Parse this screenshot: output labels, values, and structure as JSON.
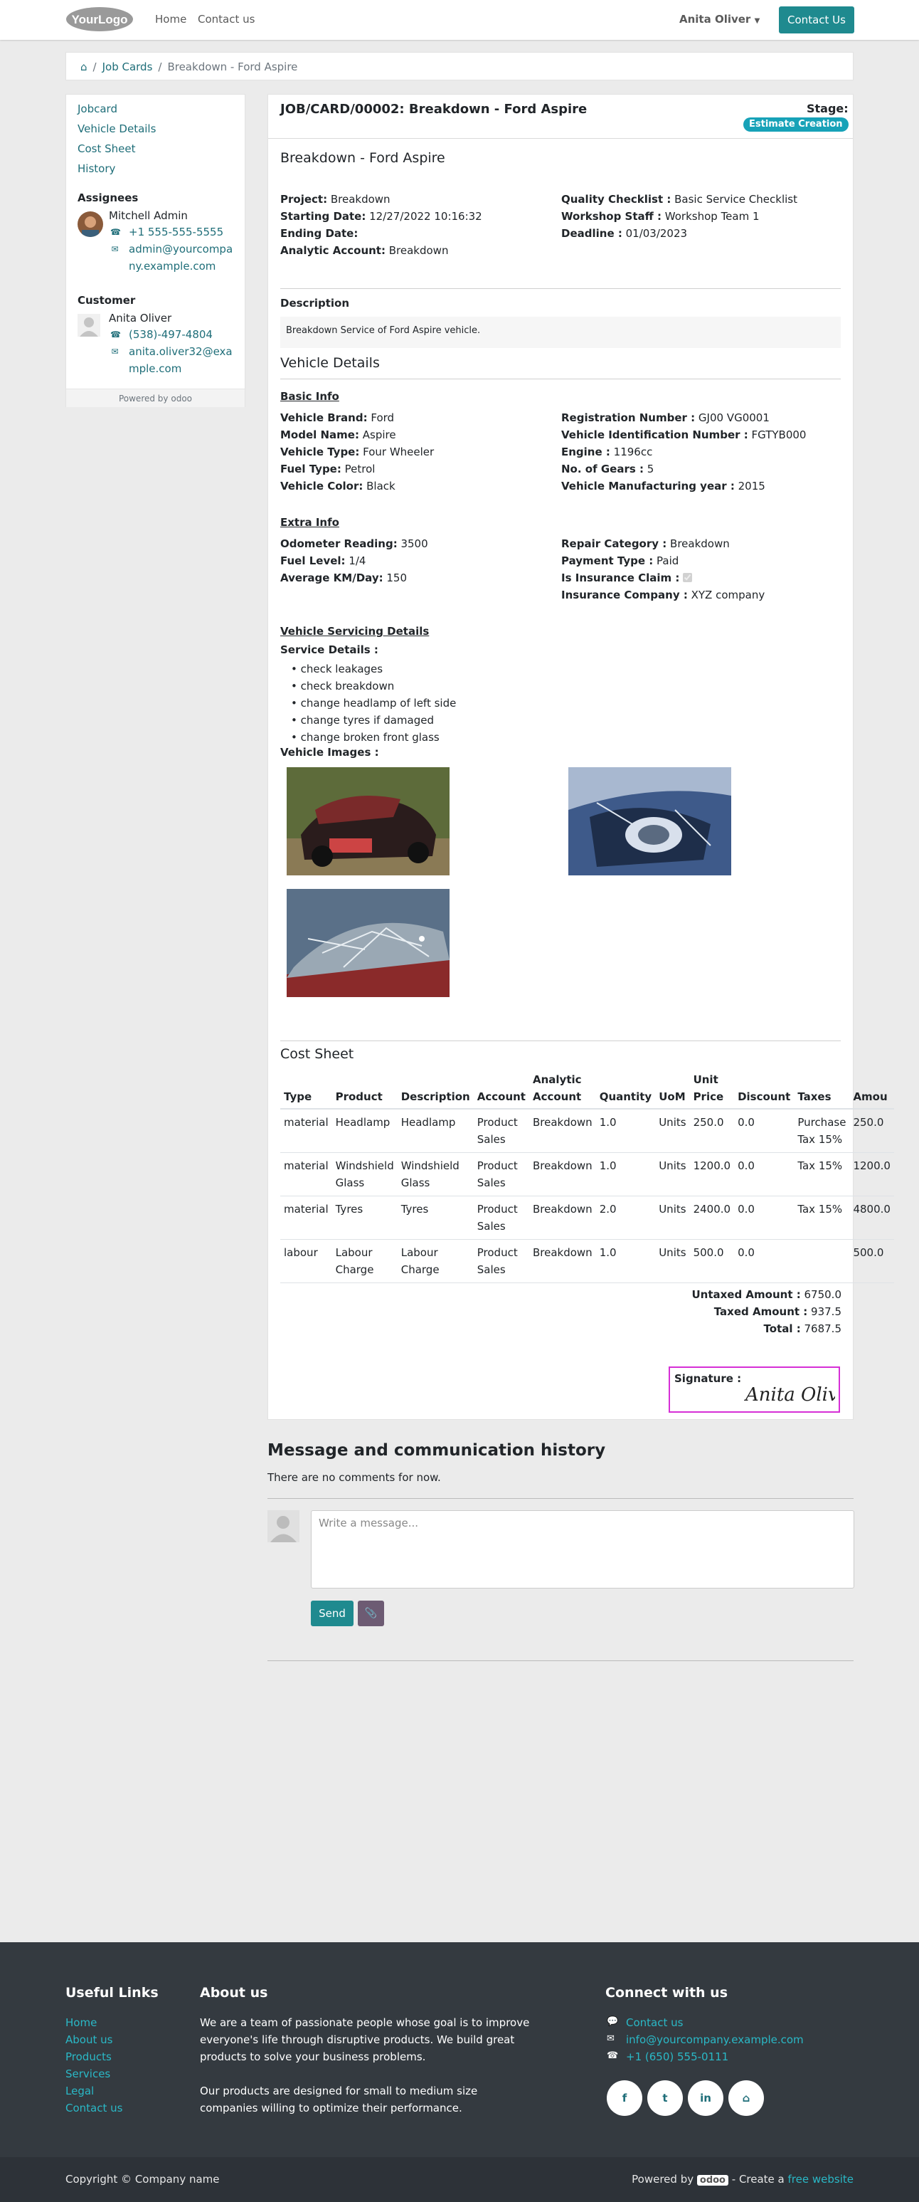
{
  "nav": {
    "logo_text": "YourLogo",
    "home": "Home",
    "contact_us": "Contact us",
    "user": "Anita Oliver",
    "cta": "Contact Us"
  },
  "breadcrumb": {
    "home_icon": "home-icon",
    "job_cards": "Job Cards",
    "current": "Breakdown - Ford Aspire"
  },
  "sidebar": {
    "links": [
      "Jobcard",
      "Vehicle Details",
      "Cost Sheet",
      "History"
    ],
    "assignees_heading": "Assignees",
    "assignee_name": "Mitchell Admin",
    "assignee_phone": "+1 555-555-5555",
    "assignee_email_1": "admin@yourcompa",
    "assignee_email_2": "ny.example.com",
    "customer_heading": "Customer",
    "customer_name": "Anita Oliver",
    "customer_phone": "(538)-497-4804",
    "customer_email_1": "anita.oliver32@exa",
    "customer_email_2": "mple.com",
    "powered_by": "Powered by",
    "odoo": "odoo"
  },
  "jobcard": {
    "header": "JOB/CARD/00002: Breakdown - Ford Aspire",
    "stage_label": "Stage:",
    "stage": "Estimate Creation",
    "title": "Breakdown - Ford Aspire",
    "left_fields": [
      {
        "label": "Project:",
        "value": " Breakdown"
      },
      {
        "label": "Starting Date:",
        "value": " 12/27/2022 10:16:32"
      },
      {
        "label": "Ending Date:",
        "value": ""
      },
      {
        "label": "Analytic Account:",
        "value": " Breakdown"
      }
    ],
    "right_fields": [
      {
        "label": "Quality Checklist :",
        "value": " Basic Service Checklist"
      },
      {
        "label": "Workshop Staff :",
        "value": " Workshop Team 1"
      },
      {
        "label": "Deadline :",
        "value": " 01/03/2023"
      }
    ],
    "description_heading": "Description",
    "description": "Breakdown Service of Ford Aspire vehicle."
  },
  "vehicle": {
    "heading": "Vehicle Details",
    "basic_heading": "Basic Info",
    "basic_left": [
      {
        "label": "Vehicle Brand:",
        "value": " Ford"
      },
      {
        "label": "Model Name:",
        "value": " Aspire"
      },
      {
        "label": "Vehicle Type:",
        "value": " Four Wheeler"
      },
      {
        "label": "Fuel Type:",
        "value": " Petrol"
      },
      {
        "label": "Vehicle Color:",
        "value": " Black"
      }
    ],
    "basic_right": [
      {
        "label": "Registration Number :",
        "value": " GJ00 VG0001"
      },
      {
        "label": "Vehicle Identification Number :",
        "value": " FGTYB000"
      },
      {
        "label": "Engine :",
        "value": " 1196cc"
      },
      {
        "label": "No. of Gears :",
        "value": " 5"
      },
      {
        "label": "Vehicle Manufacturing year :",
        "value": " 2015"
      }
    ],
    "extra_heading": "Extra Info",
    "extra_left": [
      {
        "label": "Odometer Reading:",
        "value": " 3500"
      },
      {
        "label": "Fuel Level:",
        "value": " 1/4"
      },
      {
        "label": "Average KM/Day:",
        "value": " 150"
      }
    ],
    "extra_right": [
      {
        "label": "Repair Category :",
        "value": " Breakdown"
      },
      {
        "label": "Payment Type :",
        "value": " Paid"
      },
      {
        "label": "Is Insurance Claim :",
        "value": ""
      },
      {
        "label": "Insurance Company :",
        "value": " XYZ company"
      }
    ],
    "insurance_claim_checked": true,
    "servicing_heading": "Vehicle Servicing Details",
    "service_details_label": "Service Details :",
    "services": [
      "check leakages",
      "check breakdown",
      "change headlamp of left side",
      "change tyres if damaged",
      "change broken front glass"
    ],
    "images_label": "Vehicle Images :"
  },
  "cost": {
    "heading": "Cost Sheet",
    "columns": [
      "Type",
      "Product",
      "Description",
      "Account",
      "Analytic Account",
      "Quantity",
      "UoM",
      "Unit Price",
      "Discount",
      "Taxes",
      "Amou"
    ],
    "rows": [
      [
        "material",
        "Headlamp",
        "Headlamp",
        "Product Sales",
        "Breakdown",
        "1.0",
        "Units",
        "250.0",
        "0.0",
        "Purchase Tax 15%",
        "250.0"
      ],
      [
        "material",
        "Windshield Glass",
        "Windshield Glass",
        "Product Sales",
        "Breakdown",
        "1.0",
        "Units",
        "1200.0",
        "0.0",
        "Tax 15%",
        "1200.0"
      ],
      [
        "material",
        "Tyres",
        "Tyres",
        "Product Sales",
        "Breakdown",
        "2.0",
        "Units",
        "2400.0",
        "0.0",
        "Tax 15%",
        "4800.0"
      ],
      [
        "labour",
        "Labour Charge",
        "Labour Charge",
        "Product Sales",
        "Breakdown",
        "1.0",
        "Units",
        "500.0",
        "0.0",
        "",
        "500.0"
      ]
    ],
    "untaxed_label": "Untaxed Amount :",
    "untaxed": " 6750.0",
    "taxed_label": "Taxed Amount :",
    "taxed": " 937.5",
    "total_label": "Total :",
    "total": " 7687.5",
    "signature_label": "Signature :",
    "signature": "Anita Oliver"
  },
  "chatter": {
    "heading": "Message and communication history",
    "empty": "There are no comments for now.",
    "placeholder": "Write a message...",
    "send": "Send"
  },
  "footer": {
    "useful_links_heading": "Useful Links",
    "useful_links": [
      "Home",
      "About us",
      "Products",
      "Services",
      "Legal",
      "Contact us"
    ],
    "about_heading": "About us",
    "about_p1_lines": [
      "We are a team of passionate people whose goal is to improve",
      "everyone's life through disruptive products. We build great",
      "products to solve your business problems."
    ],
    "about_p2_lines": [
      "Our products are designed for small to medium size",
      "companies willing to optimize their performance."
    ],
    "connect_heading": "Connect with us",
    "contact": "Contact us",
    "email": "info@yourcompany.example.com",
    "phone": "+1 (650) 555-0111",
    "social": [
      "f",
      "t",
      "in",
      "⌂"
    ],
    "copyright": "Copyright © Company name",
    "powered_by": "Powered by",
    "odoo": "odoo",
    "create": " - Create a ",
    "free_website": "free website"
  }
}
